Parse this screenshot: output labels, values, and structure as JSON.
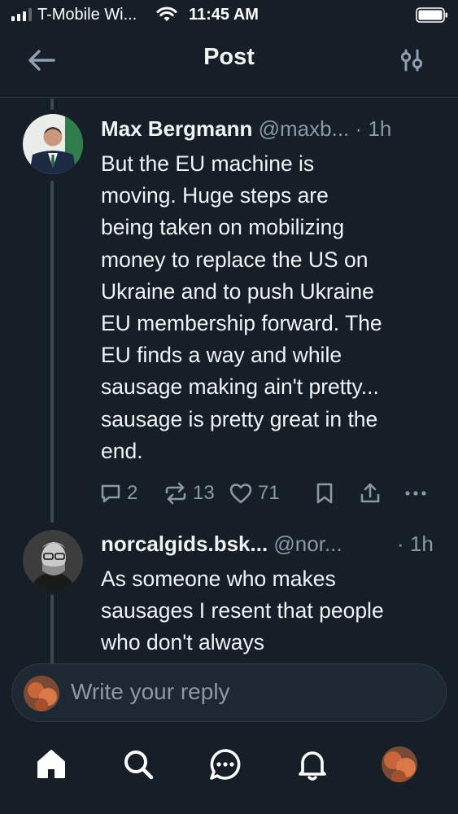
{
  "status_bar": {
    "carrier": "T-Mobile Wi...",
    "time": "11:45 AM"
  },
  "header": {
    "title": "Post",
    "back_icon": "arrow-left-icon",
    "filter_icon": "sliders-icon"
  },
  "posts": [
    {
      "author": "Max Bergmann",
      "handle": "@maxb...",
      "time": "· 1h",
      "lines": [
        "But the EU machine is",
        "moving. Huge steps are",
        "being taken on mobilizing",
        "money to replace the US on",
        "Ukraine and to push Ukraine",
        "EU membership forward. The",
        "EU finds a way and while",
        "sausage making ain't pretty...",
        "sausage is pretty great in the",
        "end."
      ],
      "replies": "2",
      "reposts": "13",
      "likes": "71"
    },
    {
      "author": "norcalgids.bsk...",
      "handle": "@nor...",
      "time": "· 1h",
      "lines": [
        "As someone who makes",
        "sausages I resent that people",
        "who don't always"
      ]
    }
  ],
  "reply_bar": {
    "placeholder": "Write your reply"
  },
  "tab_bar": {
    "icons": [
      "home-icon",
      "search-icon",
      "chat-icon",
      "bell-icon",
      "profile-avatar"
    ]
  },
  "colors": {
    "background": "#161e27",
    "text": "#f1f3f5",
    "muted": "#8b98a5",
    "thread_line": "#3a4754"
  }
}
